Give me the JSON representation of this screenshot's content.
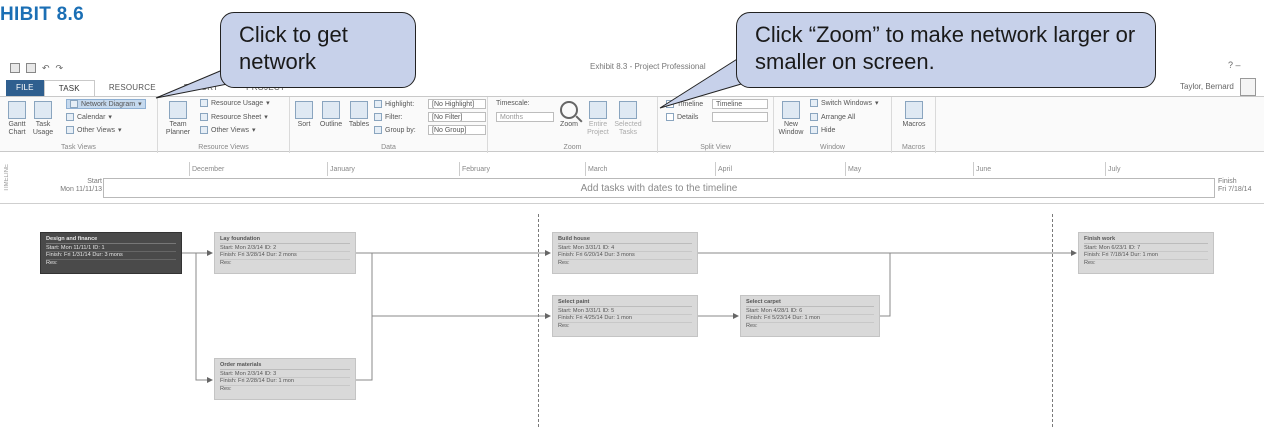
{
  "exhibit": "HIBIT 8.6",
  "window": {
    "title": "Exhibit 8.3 - Project Professional",
    "user": "Taylor, Bernard"
  },
  "tabs": [
    "FILE",
    "TASK",
    "RESOURCE",
    "REPORT",
    "PROJECT"
  ],
  "ribbon": {
    "task_views": {
      "gantt": "Gantt Chart",
      "task_usage": "Task Usage",
      "network": "Network Diagram",
      "calendar": "Calendar",
      "other": "Other Views",
      "label": "Task Views"
    },
    "resource_views": {
      "team_planner": "Team Planner",
      "resource_usage": "Resource Usage",
      "resource_sheet": "Resource Sheet",
      "other": "Other Views",
      "label": "Resource Views"
    },
    "data": {
      "sort": "Sort",
      "outline": "Outline",
      "tables": "Tables",
      "highlight_label": "Highlight:",
      "highlight_value": "[No Highlight]",
      "filter_label": "Filter:",
      "filter_value": "[No Filter]",
      "group_label": "Group by:",
      "group_value": "[No Group]",
      "label": "Data"
    },
    "zoom": {
      "timescale_label": "Timescale:",
      "timescale_value": "Months",
      "zoom": "Zoom",
      "entire_project": "Entire Project",
      "selected_tasks": "Selected Tasks",
      "label": "Zoom"
    },
    "split_view": {
      "timeline": "Timeline",
      "timeline_value": "Timeline",
      "details": "Details",
      "label": "Split View"
    },
    "window": {
      "new_window": "New Window",
      "switch_windows": "Switch Windows",
      "arrange_all": "Arrange All",
      "hide": "Hide",
      "label": "Window"
    },
    "macros": {
      "macros": "Macros",
      "label": "Macros"
    }
  },
  "timeline": {
    "side_label": "TIMELINE",
    "start_label": "Start",
    "start_date": "Mon 11/11/13",
    "finish_label": "Finish",
    "finish_date": "Fri 7/18/14",
    "message": "Add tasks with dates to the timeline",
    "months": [
      "December",
      "January",
      "February",
      "March",
      "April",
      "May",
      "June",
      "July"
    ]
  },
  "network": [
    {
      "name": "Design and finance",
      "start": "Start: Mon 11/11/1 ID: 1",
      "finish": "Finish: Fri 1/31/14 Dur: 3 mons",
      "res": "Res:",
      "critical": true
    },
    {
      "name": "Lay foundation",
      "start": "Start: Mon 2/3/14 ID: 2",
      "finish": "Finish: Fri 3/28/14 Dur: 2 mons",
      "res": "Res:",
      "critical": false
    },
    {
      "name": "Order materials",
      "start": "Start: Mon 2/3/14 ID: 3",
      "finish": "Finish: Fri 2/28/14 Dur: 1 mon",
      "res": "Res:",
      "critical": false
    },
    {
      "name": "Build house",
      "start": "Start: Mon 3/31/1 ID: 4",
      "finish": "Finish: Fri 6/20/14 Dur: 3 mons",
      "res": "Res:",
      "critical": false
    },
    {
      "name": "Select paint",
      "start": "Start: Mon 3/31/1 ID: 5",
      "finish": "Finish: Fri 4/25/14 Dur: 1 mon",
      "res": "Res:",
      "critical": false
    },
    {
      "name": "Select carpet",
      "start": "Start: Mon 4/28/1 ID: 6",
      "finish": "Finish: Fri 5/23/14 Dur: 1 mon",
      "res": "Res:",
      "critical": false
    },
    {
      "name": "Finish work",
      "start": "Start: Mon 6/23/1 ID: 7",
      "finish": "Finish: Fri 7/18/14 Dur: 1 mon",
      "res": "Res:",
      "critical": false
    }
  ],
  "callouts": {
    "network": "Click to get network",
    "zoom": "Click “Zoom” to make network larger or smaller on screen."
  },
  "colors": {
    "accent": "#1b6fb5",
    "callout": "#c7d1ea",
    "critical_node": "#4a4a4a",
    "node": "#d9d9d9"
  }
}
